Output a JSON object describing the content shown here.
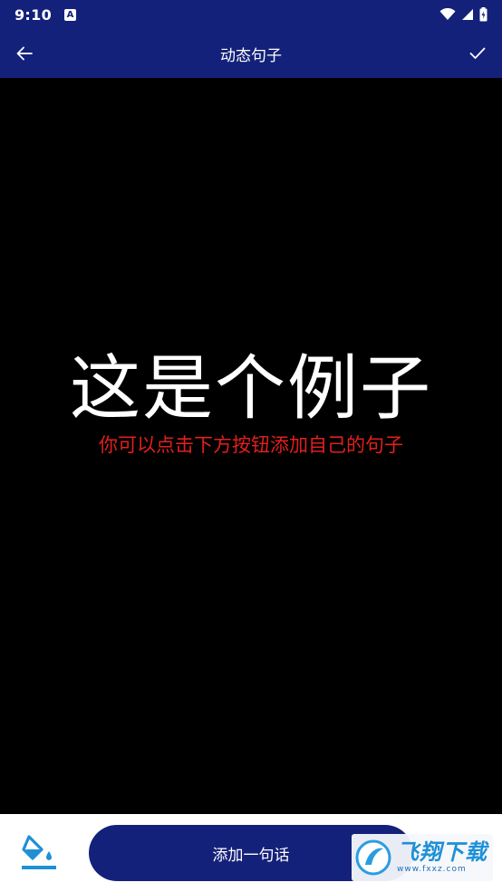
{
  "status_bar": {
    "time": "9:10",
    "notification_icon": "A"
  },
  "app_bar": {
    "title": "动态句子",
    "back_icon": "arrow-left-icon",
    "confirm_icon": "check-icon"
  },
  "preview": {
    "main_text": "这是个例子",
    "sub_text": "你可以点击下方按钮添加自己的句子",
    "main_color": "#ffffff",
    "sub_color": "#e0201c",
    "background": "#000000"
  },
  "bottom_bar": {
    "bucket_icon": "paint-bucket-icon",
    "add_button_label": "添加一句话"
  },
  "watermark": {
    "brand": "飞翔下载",
    "url": "www.fxxz.com"
  },
  "colors": {
    "primary": "#14217a",
    "accent": "#1e90d6"
  }
}
